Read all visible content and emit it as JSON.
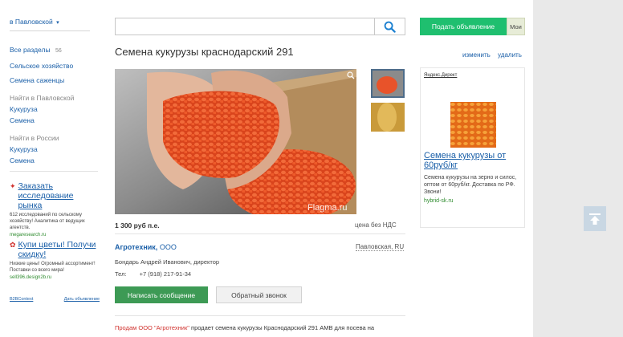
{
  "region": {
    "label": "в Павловской",
    "chevron": "▾"
  },
  "sidebar": {
    "all_sections": "Все разделы",
    "all_count": "56",
    "cat1": "Сельское хозяйство",
    "cat2": "Семена саженцы",
    "find_local": "Найти в Павловской",
    "local1": "Кукуруза",
    "local2": "Семена",
    "find_russia": "Найти в России",
    "russia1": "Кукуруза",
    "russia2": "Семена"
  },
  "ads_left": [
    {
      "title": "Заказать исследование рынка",
      "text": "612 исследований по сельскому хозяйству! Аналитика от ведущих агентств.",
      "url": "megaresearch.ru"
    },
    {
      "title": "Купи цветы! Получи скидку!",
      "text": "Низкие цены! Огромный ассортимент! Поставки со всего мира!",
      "url": "sell396.design2b.ru"
    }
  ],
  "ads_footer": {
    "network": "B2BContext",
    "post": "Дать объявление"
  },
  "search": {
    "placeholder": ""
  },
  "listing": {
    "title": "Семена кукурузы краснодарский 291",
    "edit": "изменить",
    "delete": "удалить",
    "watermark": "Flagma.ru",
    "price": "1 300 руб п.е.",
    "vat": "цена без НДС",
    "company": "Агротехник,",
    "company_type": "ООО",
    "location": "Павловская, RU",
    "contact": "Бондарь Андрей Иванович, директор",
    "phone_label": "Тел:",
    "phone": "+7 (918) 217-91-34",
    "btn_message": "Написать сообщение",
    "btn_callback": "Обратный звонок",
    "desc_tag": "Продам",
    "desc_company": "ООО \"Агротехник\"",
    "desc_text": "продает семена кукурузы Краснодарский 291 АМВ для посева на"
  },
  "right": {
    "post_btn": "Подать объявление",
    "my_btn": "Мои",
    "direct": "Яндекс.Директ",
    "ad_title": "Семена кукурузы от 60руб/кг",
    "ad_text": "Семена кукурузы на зерно и силос, оптом от 60руб/кг. Доставка по РФ. Звони!",
    "ad_url": "hybrid-sk.ru"
  },
  "colors": {
    "accent": "#1fbf6f",
    "link": "#1a5fa8",
    "button_green": "#3d9a55",
    "red": "#d0312d"
  }
}
